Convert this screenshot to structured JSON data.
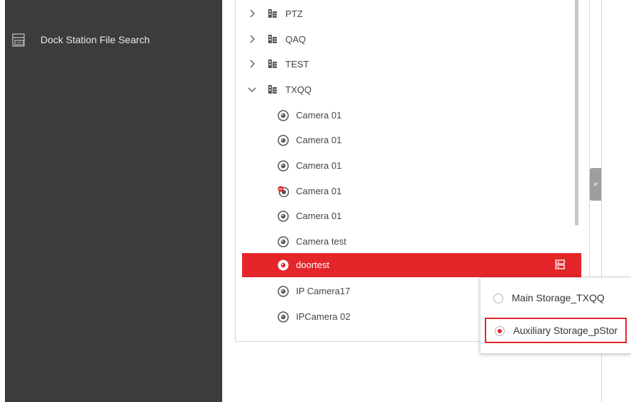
{
  "sidebar": {
    "items": [
      {
        "label": "Dock Station File Search",
        "icon": "dock-station-icon"
      }
    ]
  },
  "tree": {
    "groups": [
      {
        "label": "PTZ",
        "expanded": false
      },
      {
        "label": "QAQ",
        "expanded": false
      },
      {
        "label": "TEST",
        "expanded": false
      },
      {
        "label": "TXQQ",
        "expanded": true
      }
    ],
    "cameras": [
      {
        "label": "Camera 01",
        "status": "online"
      },
      {
        "label": "Camera 01",
        "status": "online"
      },
      {
        "label": "Camera 01",
        "status": "online"
      },
      {
        "label": "Camera 01",
        "status": "offline"
      },
      {
        "label": "Camera 01",
        "status": "online"
      },
      {
        "label": "Camera test",
        "status": "online"
      },
      {
        "label": "doortest",
        "status": "online",
        "selected": true
      },
      {
        "label": "IP Camera17",
        "status": "online"
      },
      {
        "label": "IPCamera 02",
        "status": "online"
      }
    ]
  },
  "collapse_handle": {
    "glyph": "«"
  },
  "storage_popup": {
    "options": [
      {
        "label": "Main Storage_TXQQ",
        "checked": false
      },
      {
        "label": "Auxiliary Storage_pStor",
        "checked": true
      }
    ]
  },
  "colors": {
    "accent": "#e4262a",
    "sidebar_bg": "#3c3c3c"
  }
}
